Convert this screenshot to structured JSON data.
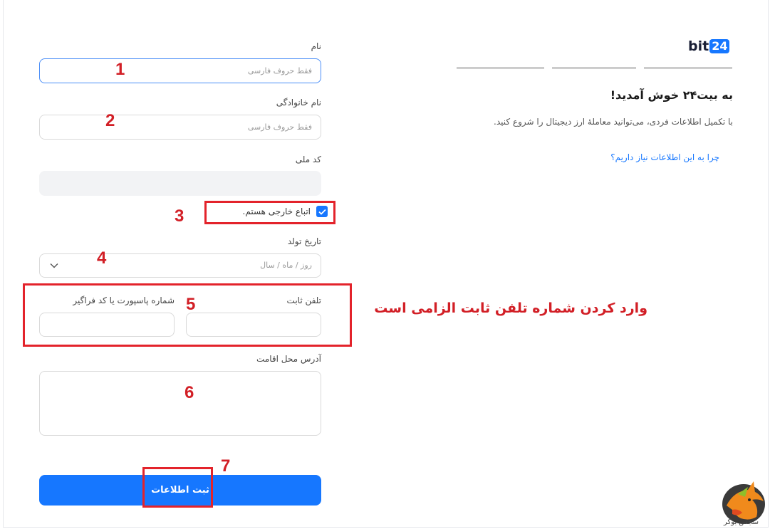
{
  "brand": {
    "logo_text": "bit",
    "logo_badge": "24"
  },
  "welcome": {
    "title": "به بیت۲۴ خوش آمدید!",
    "subtitle": "با تکمیل اطلاعات فردی، می‌توانید معاملهٔ ارز دیجیتال را شروع کنید.",
    "why_link": "چرا به این اطلاعات نیاز داریم؟"
  },
  "form": {
    "first_name": {
      "label": "نام",
      "placeholder": "فقط حروف فارسی",
      "value": ""
    },
    "last_name": {
      "label": "نام خانوادگی",
      "placeholder": "فقط حروف فارسی",
      "value": ""
    },
    "national_code": {
      "label": "کد ملی",
      "value": ""
    },
    "foreign_checkbox": {
      "label": "اتباع خارجی هستم.",
      "checked": true
    },
    "birth_date": {
      "label": "تاریخ تولد",
      "placeholder": "روز / ماه / سال"
    },
    "landline": {
      "label": "تلفن ثابت",
      "value": ""
    },
    "passport": {
      "label": "شماره پاسپورت یا کد فراگیر",
      "value": ""
    },
    "address": {
      "label": "آدرس محل اقامت",
      "value": ""
    },
    "submit_label": "ثبت اطلاعات"
  },
  "annotations": {
    "numbers": [
      "1",
      "2",
      "3",
      "4",
      "5",
      "6",
      "7"
    ],
    "note": "وارد کردن شماره تلفن ثابت الزامی است",
    "color": "#e3232b"
  },
  "watermark": {
    "text": "سجس بوکر"
  },
  "colors": {
    "primary": "#1677ff",
    "annotation": "#d21f26"
  }
}
